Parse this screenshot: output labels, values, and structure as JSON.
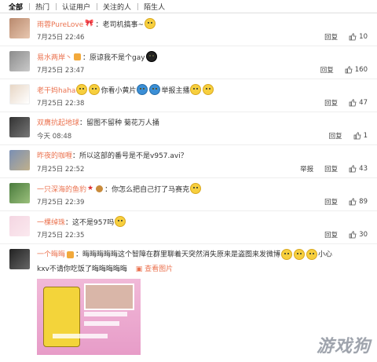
{
  "tabs": [
    "全部",
    "热门",
    "认证用户",
    "关注的人",
    "陌生人"
  ],
  "comments": [
    {
      "user": "雨蓉PureLove",
      "text": "：老司机搞事~",
      "time": "7月25日 22:46",
      "reply": "回复",
      "likes": "10"
    },
    {
      "user": "易水两岸丶",
      "text": "：原谅我不是个gay",
      "time": "7月25日 23:47",
      "reply": "回复",
      "likes": "160"
    },
    {
      "user": "老干妈haha",
      "text": "你看小黄片",
      "text2": "举报主播",
      "time": "7月25日 22:38",
      "reply": "回复",
      "likes": "47"
    },
    {
      "user": "双膺抗起地球",
      "text": "：留图不留种 菊花万人捅",
      "time": "今天 08:48",
      "reply": "回复",
      "likes": "1"
    },
    {
      "user": "昨夜的咖喱",
      "text": "：所以这部的番号是不是v957.avi？",
      "time": "7月25日 22:52",
      "report": "举报",
      "reply": "回复",
      "likes": "43"
    },
    {
      "user": "一只深海的鱼豹",
      "text": "：你怎么把自己打了马赛克",
      "time": "7月25日 22:39",
      "reply": "回复",
      "likes": "89"
    },
    {
      "user": "一棵绰珠",
      "text": "：这不是957吗",
      "time": "7月25日 22:35",
      "reply": "回复",
      "likes": "30"
    }
  ],
  "last": {
    "user": "一个晦晦",
    "text": "：晦晦晦晦晦这个智障在群里聊着天突然消失原来是盗图来发微博",
    "text_end": "小心",
    "line2": "kxv不请你吃饭了晦晦晦晦晦",
    "view_pic": "查看图片"
  },
  "watermark": "游戏狗"
}
